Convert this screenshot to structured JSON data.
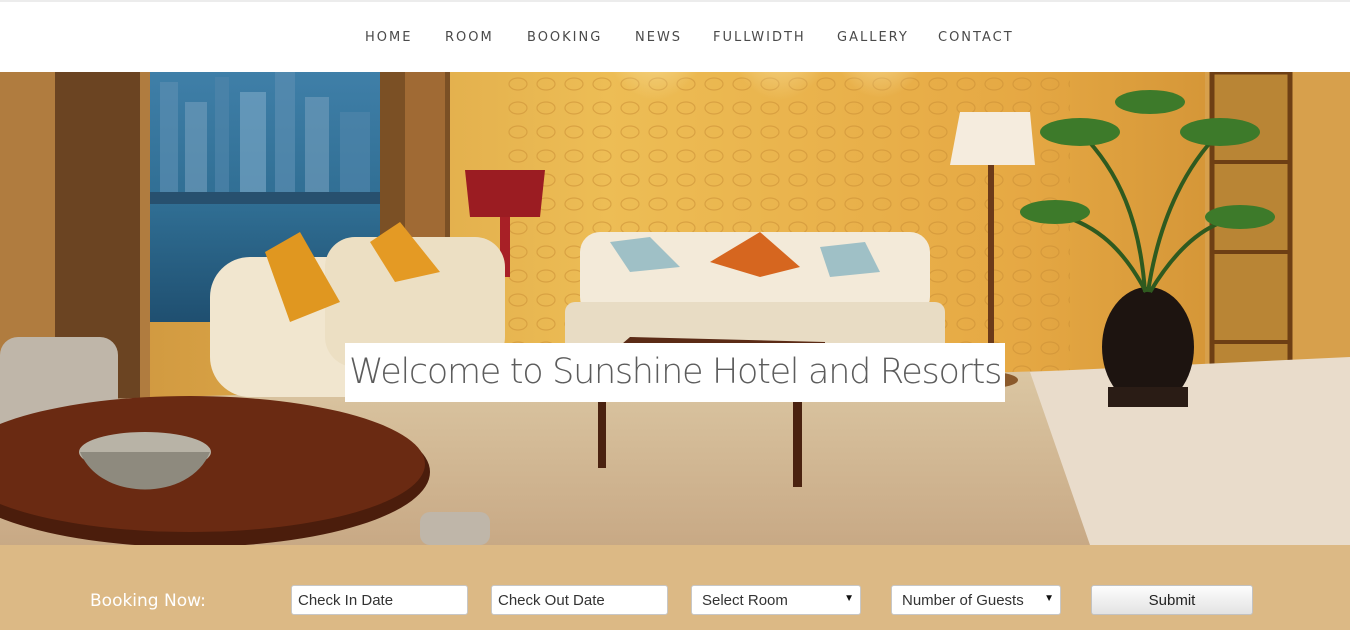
{
  "nav": {
    "items": [
      {
        "label": "HOME"
      },
      {
        "label": "ROOM"
      },
      {
        "label": "BOOKING"
      },
      {
        "label": "NEWS"
      },
      {
        "label": "FULLWIDTH"
      },
      {
        "label": "GALLERY"
      },
      {
        "label": "CONTACT"
      }
    ]
  },
  "hero": {
    "title": "Welcome to Sunshine Hotel and Resorts"
  },
  "booking": {
    "label": "Booking Now:",
    "check_in_placeholder": "Check In Date",
    "check_out_placeholder": "Check Out Date",
    "room_select": "Select Room",
    "guests_select": "Number of Guests",
    "submit_label": "Submit"
  },
  "colors": {
    "booking_bar": "#dcb985",
    "nav_text": "#4a4a4a",
    "hero_wall": "#e0a843"
  }
}
